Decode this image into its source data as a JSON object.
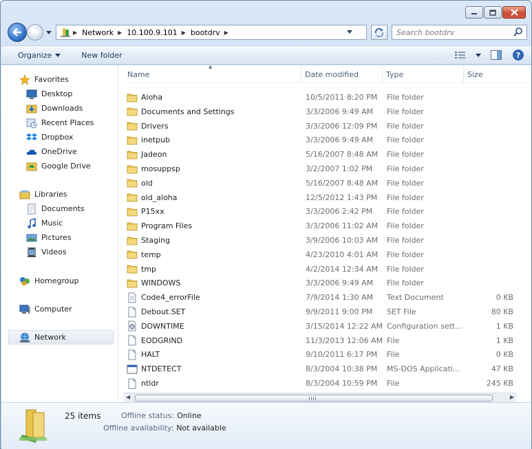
{
  "window": {
    "caption_buttons": [
      "minimize-icon",
      "maximize-icon",
      "close-icon"
    ]
  },
  "address": {
    "breadcrumbs": [
      "Network",
      "10.100.9.101",
      "bootdrv"
    ]
  },
  "search": {
    "placeholder": "Search bootdrv"
  },
  "toolbar": {
    "organize_label": "Organize",
    "new_folder_label": "New folder"
  },
  "navpane": {
    "favorites": {
      "label": "Favorites",
      "items": [
        {
          "label": "Desktop",
          "icon": "desktop-icon"
        },
        {
          "label": "Downloads",
          "icon": "downloads-icon"
        },
        {
          "label": "Recent Places",
          "icon": "recent-places-icon"
        },
        {
          "label": "Dropbox",
          "icon": "dropbox-icon"
        },
        {
          "label": "OneDrive",
          "icon": "onedrive-icon"
        },
        {
          "label": "Google Drive",
          "icon": "google-drive-icon"
        }
      ]
    },
    "libraries": {
      "label": "Libraries",
      "items": [
        {
          "label": "Documents",
          "icon": "documents-icon"
        },
        {
          "label": "Music",
          "icon": "music-icon"
        },
        {
          "label": "Pictures",
          "icon": "pictures-icon"
        },
        {
          "label": "Videos",
          "icon": "videos-icon"
        }
      ]
    },
    "homegroup": {
      "label": "Homegroup"
    },
    "computer": {
      "label": "Computer"
    },
    "network": {
      "label": "Network"
    }
  },
  "columns": {
    "name": "Name",
    "date": "Date modified",
    "type": "Type",
    "size": "Size"
  },
  "files": [
    {
      "name": "Aloha",
      "date": "10/5/2011 8:20 PM",
      "type": "File folder",
      "size": "",
      "icon": "folder"
    },
    {
      "name": "Documents and Settings",
      "date": "3/3/2006 9:49 AM",
      "type": "File folder",
      "size": "",
      "icon": "folder"
    },
    {
      "name": "Drivers",
      "date": "3/3/2006 12:09 PM",
      "type": "File folder",
      "size": "",
      "icon": "folder"
    },
    {
      "name": "inetpub",
      "date": "3/3/2006 9:49 AM",
      "type": "File folder",
      "size": "",
      "icon": "folder"
    },
    {
      "name": "Jadeon",
      "date": "5/16/2007 8:48 AM",
      "type": "File folder",
      "size": "",
      "icon": "folder"
    },
    {
      "name": "mosuppsp",
      "date": "3/2/2007 1:02 PM",
      "type": "File folder",
      "size": "",
      "icon": "folder"
    },
    {
      "name": "old",
      "date": "5/16/2007 8:48 AM",
      "type": "File folder",
      "size": "",
      "icon": "folder"
    },
    {
      "name": "old_aloha",
      "date": "12/5/2012 1:43 PM",
      "type": "File folder",
      "size": "",
      "icon": "folder"
    },
    {
      "name": "P15xx",
      "date": "3/3/2006 2:42 PM",
      "type": "File folder",
      "size": "",
      "icon": "folder"
    },
    {
      "name": "Program Files",
      "date": "3/3/2006 11:02 AM",
      "type": "File folder",
      "size": "",
      "icon": "folder"
    },
    {
      "name": "Staging",
      "date": "3/9/2006 10:03 AM",
      "type": "File folder",
      "size": "",
      "icon": "folder"
    },
    {
      "name": "temp",
      "date": "4/23/2010 4:01 AM",
      "type": "File folder",
      "size": "",
      "icon": "folder"
    },
    {
      "name": "tmp",
      "date": "4/2/2014 12:34 AM",
      "type": "File folder",
      "size": "",
      "icon": "folder"
    },
    {
      "name": "WINDOWS",
      "date": "3/3/2006 9:49 AM",
      "type": "File folder",
      "size": "",
      "icon": "folder"
    },
    {
      "name": "Code4_errorFile",
      "date": "7/9/2014 1:30 AM",
      "type": "Text Document",
      "size": "0 KB",
      "icon": "text"
    },
    {
      "name": "Debout.SET",
      "date": "9/9/2011 9:00 PM",
      "type": "SET File",
      "size": "80 KB",
      "icon": "file"
    },
    {
      "name": "DOWNTIME",
      "date": "3/15/2014 12:22 AM",
      "type": "Configuration sett...",
      "size": "1 KB",
      "icon": "config"
    },
    {
      "name": "EODGRIND",
      "date": "11/3/2013 12:06 AM",
      "type": "File",
      "size": "1 KB",
      "icon": "file"
    },
    {
      "name": "HALT",
      "date": "9/10/2011 6:17 PM",
      "type": "File",
      "size": "0 KB",
      "icon": "file"
    },
    {
      "name": "NTDETECT",
      "date": "8/3/2004 10:38 PM",
      "type": "MS-DOS Applicati...",
      "size": "47 KB",
      "icon": "app"
    },
    {
      "name": "ntldr",
      "date": "8/3/2004 10:59 PM",
      "type": "File",
      "size": "245 KB",
      "icon": "file"
    }
  ],
  "details": {
    "count": "25 items",
    "offline_status_label": "Offline status:",
    "offline_status_value": "Online",
    "offline_availability_label": "Offline availability:",
    "offline_availability_value": "Not available"
  }
}
